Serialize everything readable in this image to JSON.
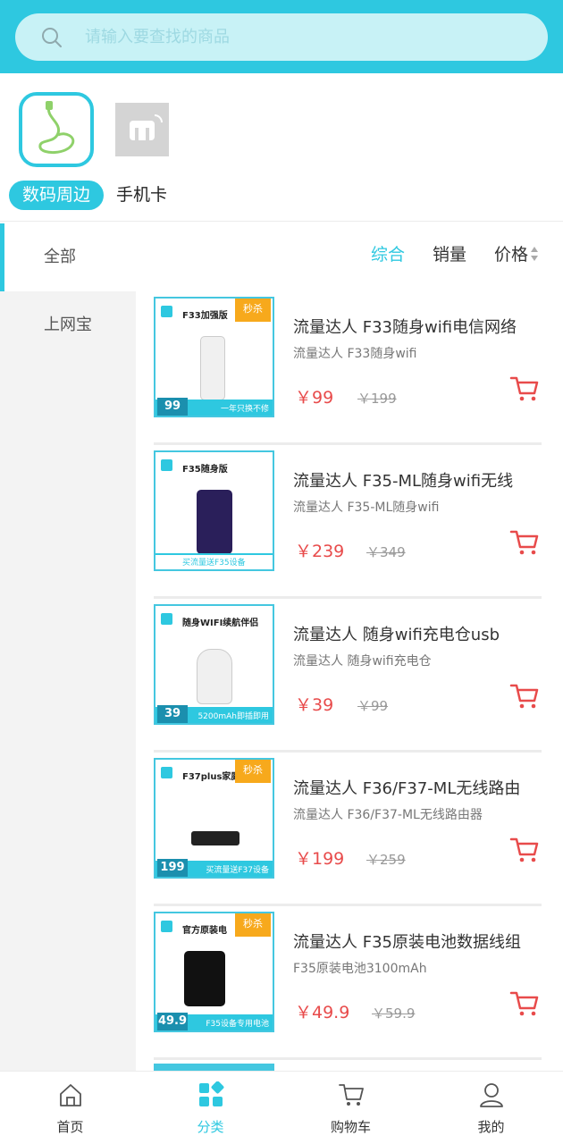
{
  "search": {
    "placeholder": "请输入要查找的商品"
  },
  "top_categories": [
    {
      "label": "数码周边",
      "active": true
    },
    {
      "label": "手机卡",
      "active": false
    }
  ],
  "sidebar": {
    "items": [
      {
        "label": "全部",
        "active": true
      },
      {
        "label": "上网宝",
        "active": false
      }
    ]
  },
  "sort": {
    "items": [
      {
        "label": "综合",
        "active": true
      },
      {
        "label": "销量",
        "active": false
      },
      {
        "label": "价格",
        "active": false
      }
    ]
  },
  "products": [
    {
      "title": "流量达人 F33随身wifi电信网络",
      "subtitle": "流量达人 F33随身wifi",
      "price": "￥99",
      "original_price": "￥199",
      "image": {
        "head": "F33加强版",
        "tag": "秒杀",
        "badge": "99",
        "banner": "一年只换不修"
      }
    },
    {
      "title": "流量达人 F35-ML随身wifi无线",
      "subtitle": "流量达人 F35-ML随身wifi",
      "price": "￥239",
      "original_price": "￥349",
      "image": {
        "head": "F35随身版",
        "tag": "",
        "badge": "",
        "banner": "买流量送F35设备"
      }
    },
    {
      "title": "流量达人 随身wifi充电仓usb",
      "subtitle": "流量达人 随身wifi充电仓",
      "price": "￥39",
      "original_price": "￥99",
      "image": {
        "head": "随身WIFI续航伴侣",
        "tag": "",
        "badge": "39",
        "banner": "5200mAh即插即用"
      }
    },
    {
      "title": "流量达人 F36/F37-ML无线路由",
      "subtitle": "流量达人  F36/F37-ML无线路由器",
      "price": "￥199",
      "original_price": "￥259",
      "image": {
        "head": "F37plus家庭",
        "tag": "秒杀",
        "badge": "199",
        "banner": "买流量送F37设备"
      }
    },
    {
      "title": "流量达人 F35原装电池数据线组",
      "subtitle": "F35原装电池3100mAh",
      "price": "￥49.9",
      "original_price": "￥59.9",
      "image": {
        "head": "官方原装电",
        "tag": "秒杀",
        "badge": "49.9",
        "banner": "F35设备专用电池"
      }
    }
  ],
  "bottom_nav": [
    {
      "label": "首页",
      "icon": "home-icon",
      "active": false
    },
    {
      "label": "分类",
      "icon": "category-grid-icon",
      "active": true
    },
    {
      "label": "购物车",
      "icon": "cart-icon",
      "active": false
    },
    {
      "label": "我的",
      "icon": "user-icon",
      "active": false
    }
  ],
  "colors": {
    "accent": "#2ec8e0",
    "price": "#e84b4b",
    "sidebar_bg": "#f3f3f3"
  }
}
